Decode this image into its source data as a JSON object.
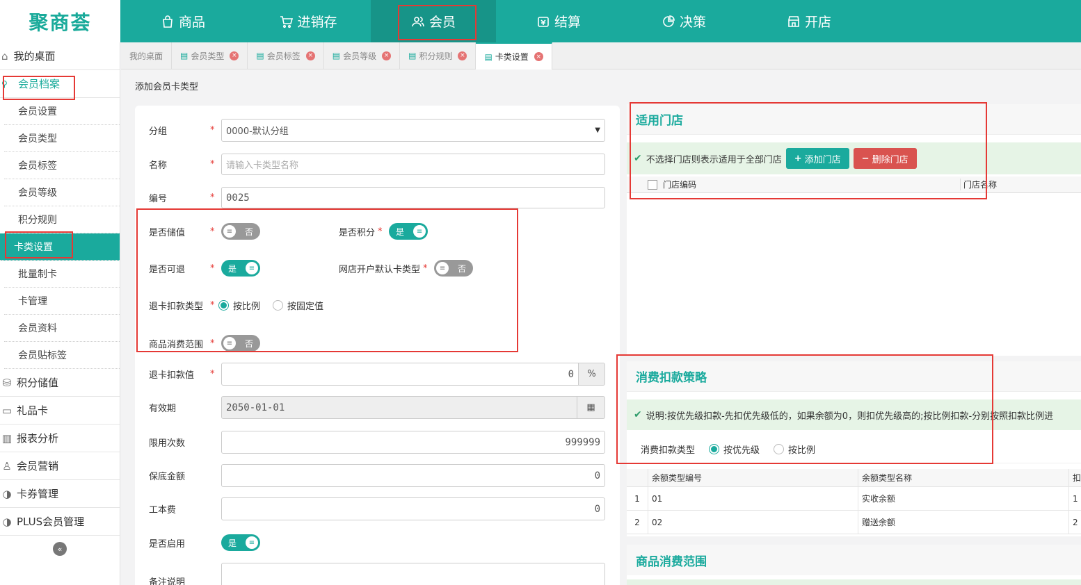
{
  "brand": {
    "logo": "聚商荟"
  },
  "topnav": [
    {
      "label": "商品",
      "icon": "bag-icon"
    },
    {
      "label": "进销存",
      "icon": "cart-icon"
    },
    {
      "label": "会员",
      "icon": "users-icon"
    },
    {
      "label": "结算",
      "icon": "wallet-icon"
    },
    {
      "label": "决策",
      "icon": "chart-icon"
    },
    {
      "label": "开店",
      "icon": "store-icon"
    }
  ],
  "sidebar": {
    "desk": "我的桌面",
    "group": "会员档案",
    "subs": [
      "会员设置",
      "会员类型",
      "会员标签",
      "会员等级",
      "积分规则",
      "卡类设置",
      "批量制卡",
      "卡管理",
      "会员资料",
      "会员贴标签"
    ],
    "mains": [
      "积分储值",
      "礼品卡",
      "报表分析",
      "会员营销",
      "卡券管理",
      "PLUS会员管理"
    ]
  },
  "tabs": [
    "我的桌面",
    "会员类型",
    "会员标签",
    "会员等级",
    "积分规则",
    "卡类设置"
  ],
  "page": {
    "title": "添加会员卡类型"
  },
  "form": {
    "group_label": "分组",
    "group_value": "0000-默认分组",
    "name_label": "名称",
    "name_placeholder": "请输入卡类型名称",
    "code_label": "编号",
    "code_value": "0025",
    "stored_label": "是否储值",
    "stored_value": "否",
    "points_label": "是否积分",
    "points_value": "是",
    "refund_label": "是否可退",
    "refund_value": "是",
    "online_label": "网店开户默认卡类型",
    "online_value": "否",
    "deduct_type_label": "退卡扣款类型",
    "deduct_opt1": "按比例",
    "deduct_opt2": "按固定值",
    "scope_label": "商品消费范围",
    "scope_value": "否",
    "deduct_value_label": "退卡扣款值",
    "deduct_value": "0",
    "deduct_unit": "%",
    "expiry_label": "有效期",
    "expiry_value": "2050-01-01",
    "limit_label": "限用次数",
    "limit_value": "999999",
    "min_label": "保底金额",
    "min_value": "0",
    "fee_label": "工本费",
    "fee_value": "0",
    "enabled_label": "是否启用",
    "enabled_value": "是",
    "remark_label": "备注说明"
  },
  "stores": {
    "title": "适用门店",
    "notice": "不选择门店则表示适用于全部门店",
    "add_btn": "添加门店",
    "del_btn": "删除门店",
    "col_code": "门店编码",
    "col_name": "门店名称"
  },
  "strategy": {
    "title": "消费扣款策略",
    "notice": "说明:按优先级扣款-先扣优先级低的，如果余额为0，则扣优先级高的;按比例扣款-分别按照扣款比例进",
    "type_label": "消费扣款类型",
    "opt1": "按优先级",
    "opt2": "按比例",
    "col1": "余额类型编号",
    "col2": "余额类型名称",
    "col3": "扣",
    "rows": [
      {
        "idx": "1",
        "code": "01",
        "name": "实收余额",
        "val": "1"
      },
      {
        "idx": "2",
        "code": "02",
        "name": "赠送余额",
        "val": "2"
      }
    ]
  },
  "scope_panel": {
    "title": "商品消费范围"
  }
}
